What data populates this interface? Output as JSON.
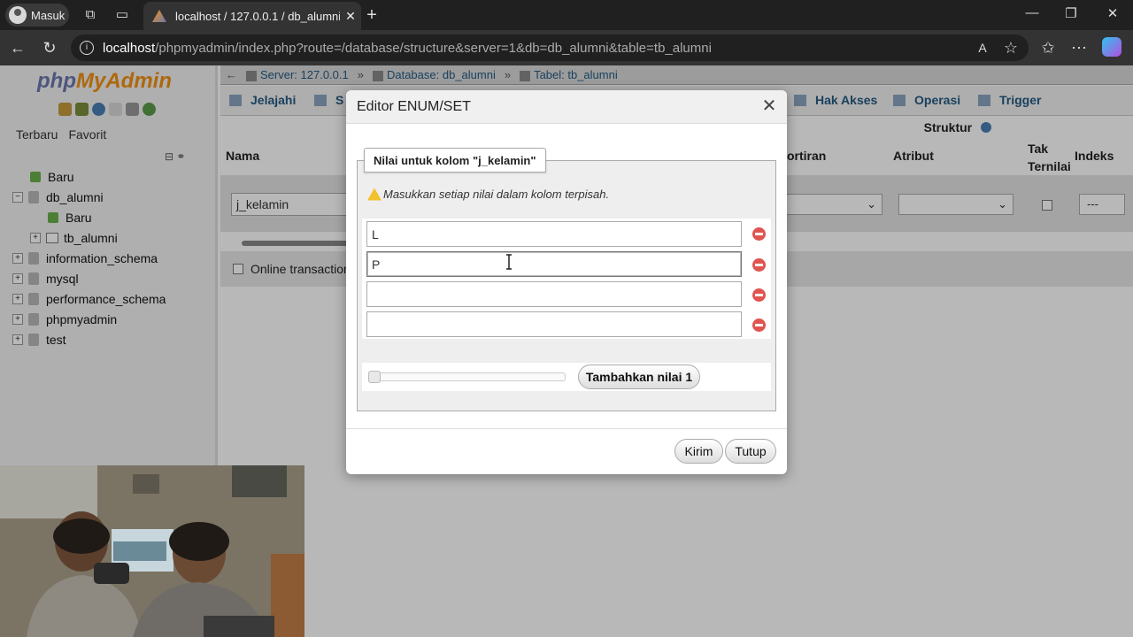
{
  "browser": {
    "profile_label": "Masuk",
    "tab_title": "localhost / 127.0.0.1 / db_alumni",
    "url_host": "localhost",
    "url_path": "/phpmyadmin/index.php?route=/database/structure&server=1&db=db_alumni&table=tb_alumni"
  },
  "sidebar": {
    "logo_php": "php",
    "logo_ma": "MyAdmin",
    "recent_label": "Terbaru",
    "favorite_label": "Favorit",
    "tree": [
      {
        "label": "Baru",
        "level": 1
      },
      {
        "label": "db_alumni",
        "level": 0
      },
      {
        "label": "Baru",
        "level": 2
      },
      {
        "label": "tb_alumni",
        "level": 1
      },
      {
        "label": "information_schema",
        "level": 0
      },
      {
        "label": "mysql",
        "level": 0
      },
      {
        "label": "performance_schema",
        "level": 0
      },
      {
        "label": "phpmyadmin",
        "level": 0
      },
      {
        "label": "test",
        "level": 0
      }
    ]
  },
  "breadcrumb": {
    "server": "Server: 127.0.0.1",
    "database": "Database: db_alumni",
    "table": "Tabel: tb_alumni"
  },
  "menu_tabs": {
    "browse": "Jelajahi",
    "structure_partial": "S",
    "privileges": "Hak Akses",
    "operations": "Operasi",
    "triggers": "Trigger"
  },
  "structure": {
    "section_label": "Struktur",
    "col_name": "Nama",
    "col_collation": "ortiran",
    "col_attribute": "Atribut",
    "col_null_1": "Tak",
    "col_null_2": "Ternilai",
    "col_index": "Indeks",
    "row_name_value": "j_kelamin",
    "index_value": "---",
    "online_transaction": "Online transaction"
  },
  "dialog": {
    "title": "Editor ENUM/SET",
    "legend": "Nilai untuk kolom \"j_kelamin\"",
    "hint": "Masukkan setiap nilai dalam kolom terpisah.",
    "values": [
      "L",
      "P",
      "",
      ""
    ],
    "add_button": "Tambahkan nilai 1",
    "submit_button": "Kirim",
    "close_button": "Tutup"
  }
}
